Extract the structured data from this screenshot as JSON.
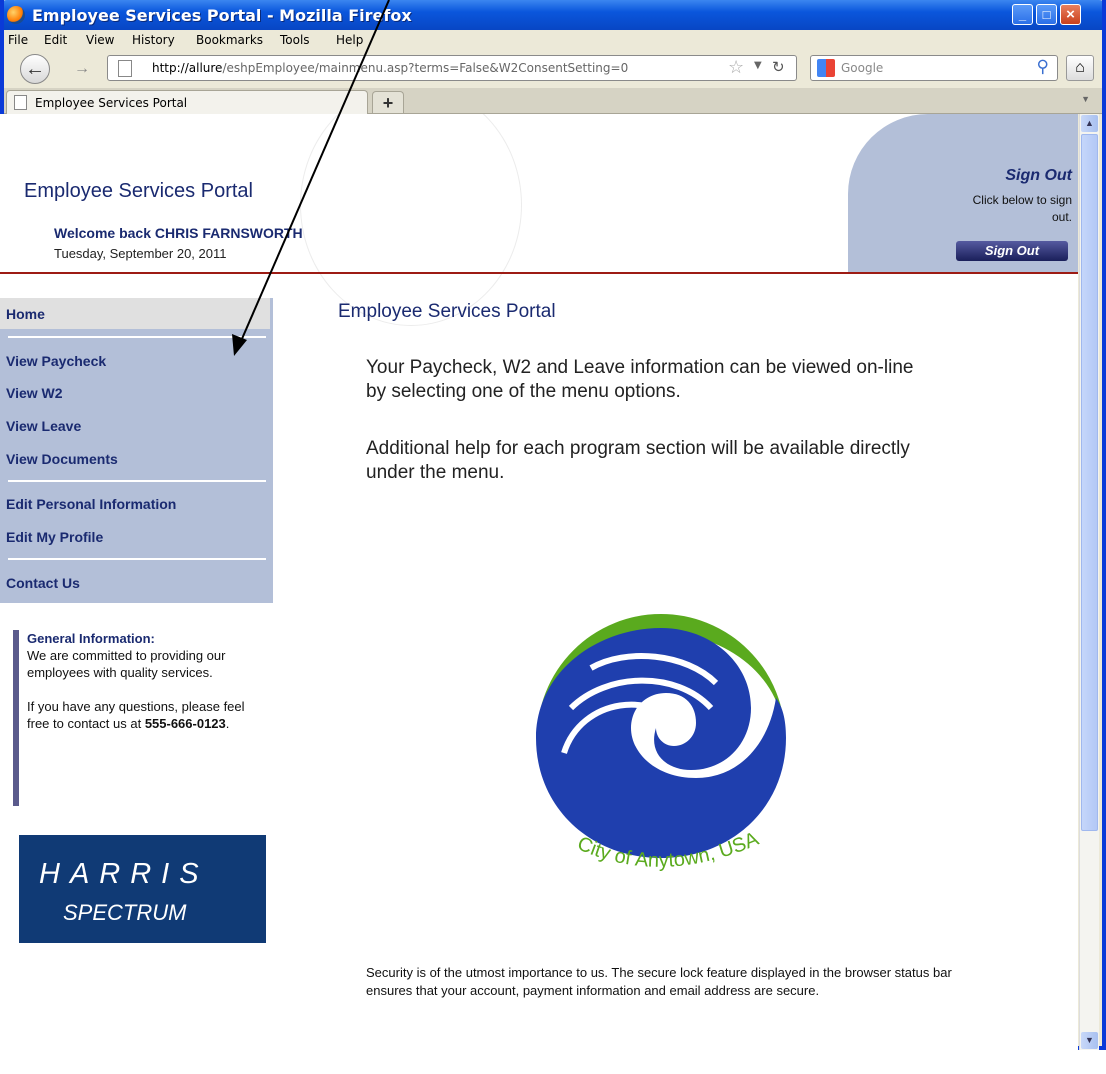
{
  "browser": {
    "window_title": "Employee Services Portal - Mozilla Firefox",
    "menu": [
      "File",
      "Edit",
      "View",
      "History",
      "Bookmarks",
      "Tools",
      "Help"
    ],
    "url_host": "http://allure",
    "url_path": "/eshpEmployee/mainmenu.asp?terms=False&W2ConsentSetting=0",
    "search_placeholder": "Google",
    "tab_label": "Employee Services Portal",
    "new_tab_symbol": "+"
  },
  "header": {
    "site_title": "Employee Services Portal",
    "welcome": "Welcome back CHRIS FARNSWORTH",
    "date": "Tuesday, September 20, 2011",
    "signout_title": "Sign Out",
    "signout_sub": "Click below to sign out.",
    "signout_button": "Sign Out"
  },
  "sidebar": {
    "items": [
      "Home",
      "View Paycheck",
      "View W2",
      "View Leave",
      "View Documents",
      "Edit Personal Information",
      "Edit My Profile",
      "Contact Us"
    ],
    "general_info": {
      "heading": "General Information:",
      "text1": "We are committed to providing our employees with quality services.",
      "text2": "If you have any questions, please feel free to contact us at",
      "phone": "555-666-0123",
      "period": "."
    },
    "harris": {
      "line1": "HARRIS",
      "line2": "SPECTRUM"
    }
  },
  "main": {
    "title": "Employee Services Portal",
    "para1": "Your Paycheck, W2 and Leave information can be viewed on-line by selecting one of the menu options.",
    "para2": "Additional help for each program section will be available directly under the menu.",
    "logo_caption": "City of Anytown, USA",
    "security": "Security is of the utmost importance to us. The secure lock feature displayed in the browser status bar ensures that your account, payment information and email address are secure."
  },
  "colors": {
    "nav_blue": "#1a2a70",
    "menu_bg": "#b3bfd8",
    "logo_green": "#5aaa1e",
    "logo_blue": "#1f3fae",
    "header_rule": "#9d1b14"
  }
}
